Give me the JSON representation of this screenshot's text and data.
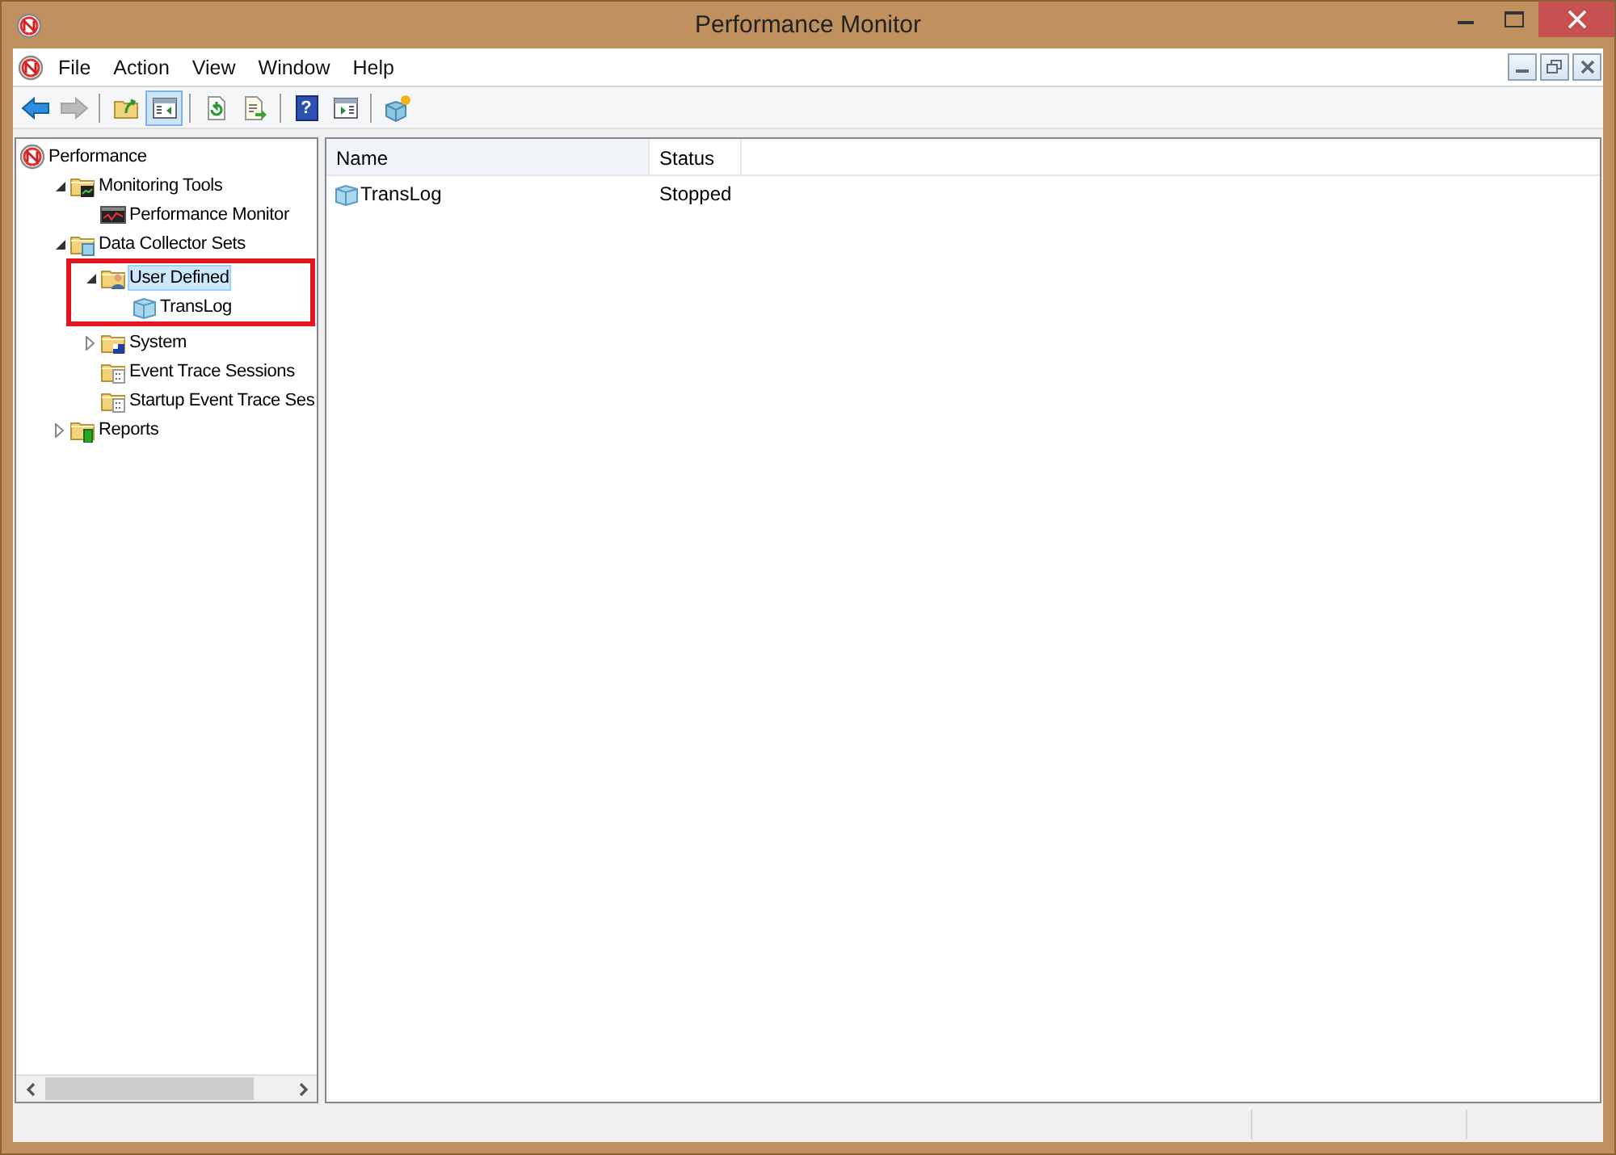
{
  "window": {
    "title": "Performance Monitor"
  },
  "menu": [
    {
      "label": "File"
    },
    {
      "label": "Action"
    },
    {
      "label": "View"
    },
    {
      "label": "Window"
    },
    {
      "label": "Help"
    }
  ],
  "toolbar": [
    {
      "kind": "back",
      "disabled": false,
      "pressed": false
    },
    {
      "kind": "forward",
      "disabled": true,
      "pressed": false
    },
    {
      "kind": "sep"
    },
    {
      "kind": "up",
      "disabled": false,
      "pressed": false
    },
    {
      "kind": "tree",
      "disabled": false,
      "pressed": true
    },
    {
      "kind": "sep"
    },
    {
      "kind": "refresh",
      "disabled": false,
      "pressed": false
    },
    {
      "kind": "export",
      "disabled": false,
      "pressed": false
    },
    {
      "kind": "sep"
    },
    {
      "kind": "help",
      "glyph": "?",
      "disabled": false,
      "pressed": false
    },
    {
      "kind": "pane",
      "disabled": false,
      "pressed": false
    },
    {
      "kind": "sep"
    },
    {
      "kind": "new",
      "disabled": false,
      "pressed": false
    }
  ],
  "tree": [
    {
      "label": "Performance",
      "selected": false,
      "highlighted": false,
      "children": [
        {
          "label": "Monitoring Tools",
          "expanded": true,
          "selected": false,
          "highlighted": false,
          "children": [
            {
              "label": "Performance Monitor",
              "selected": false,
              "highlighted": false
            }
          ]
        },
        {
          "label": "Data Collector Sets",
          "expanded": true,
          "selected": false,
          "highlighted": false,
          "children": [
            {
              "label": "User Defined",
              "expanded": true,
              "selected": true,
              "highlighted": true,
              "children": [
                {
                  "label": "TransLog",
                  "selected": false,
                  "highlighted": false
                }
              ]
            },
            {
              "label": "System",
              "expanded": false,
              "selected": false,
              "highlighted": false
            },
            {
              "label": "Event Trace Sessions",
              "selected": false,
              "highlighted": false
            },
            {
              "label": "Startup Event Trace Ses",
              "selected": false,
              "highlighted": false
            }
          ]
        },
        {
          "label": "Reports",
          "expanded": false,
          "selected": false,
          "highlighted": false
        }
      ]
    }
  ],
  "list": {
    "columns": [
      "Name",
      "Status"
    ],
    "rows": [
      {
        "name": "TransLog",
        "status": "Stopped",
        "selected": false
      }
    ]
  }
}
